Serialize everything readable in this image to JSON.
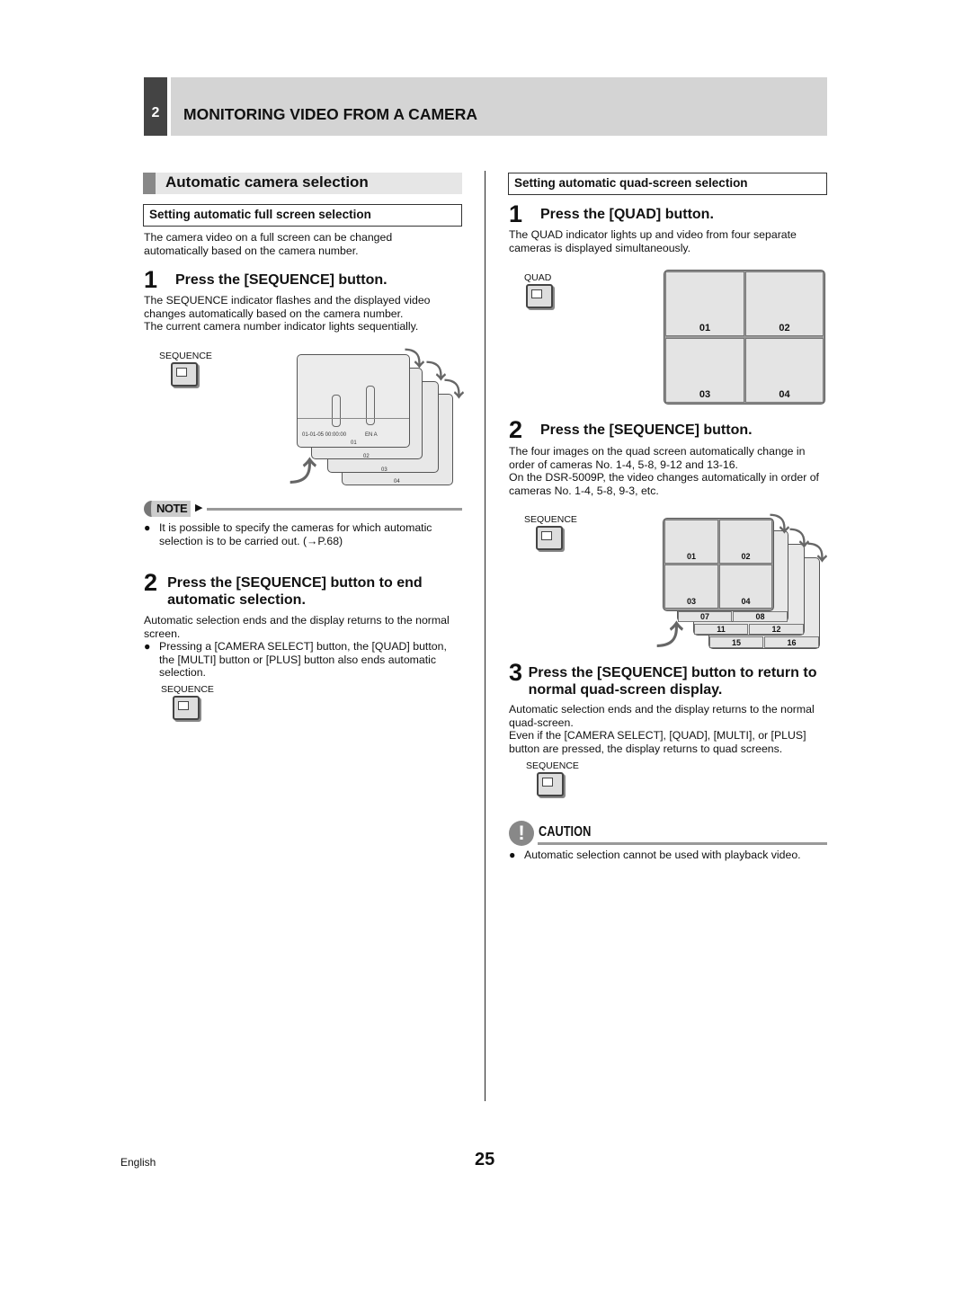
{
  "chapter": {
    "number": "2",
    "title": "MONITORING VIDEO FROM A CAMERA"
  },
  "section": {
    "title": "Automatic camera selection"
  },
  "left": {
    "subheading": "Setting automatic full screen selection",
    "intro": "The camera video on a full screen can be changed automatically based on the camera number.",
    "step1": {
      "num": "1",
      "title": "Press the [SEQUENCE] button.",
      "body": [
        "The SEQUENCE indicator flashes and the displayed video changes automatically based on the camera number.",
        "The current camera number indicator lights sequentially."
      ],
      "button_label": "SEQUENCE"
    },
    "screen_overlay": {
      "datetime": "01-01-05 00:00:00",
      "mode": "EN A",
      "cams": [
        "01",
        "02",
        "03",
        "04"
      ]
    },
    "note": {
      "label": "NOTE",
      "bullet": "It is possible to specify the cameras for which automatic selection is to be carried out. (→P.68)"
    },
    "step2": {
      "num": "2",
      "title": "Press the [SEQUENCE] button to end automatic selection.",
      "body": "Automatic selection ends and the display returns to the normal screen.",
      "bullet": "Pressing a [CAMERA SELECT] button, the [QUAD] button, the [MULTI] button or [PLUS] button also ends automatic selection.",
      "button_label": "SEQUENCE"
    }
  },
  "right": {
    "subheading": "Setting automatic quad-screen selection",
    "step1": {
      "num": "1",
      "title": "Press the [QUAD] button.",
      "body": "The QUAD indicator lights up and video from four separate cameras is displayed simultaneously.",
      "button_label": "QUAD",
      "cams": [
        "01",
        "02",
        "03",
        "04"
      ]
    },
    "step2": {
      "num": "2",
      "title": "Press the [SEQUENCE] button.",
      "body": [
        "The four images on the quad screen automatically change in order of cameras No. 1-4, 5-8, 9-12 and 13-16.",
        "On the DSR-5009P, the video changes automatically in order of cameras No. 1-4, 5-8, 9-3, etc."
      ],
      "button_label": "SEQUENCE",
      "cams": [
        "01",
        "02",
        "03",
        "04"
      ],
      "back_cams": [
        "07",
        "08",
        "11",
        "12",
        "15",
        "16"
      ]
    },
    "step3": {
      "num": "3",
      "title": "Press the [SEQUENCE] button to return to normal quad-screen display.",
      "body": [
        "Automatic selection ends and the display returns to the normal quad-screen.",
        "Even if the [CAMERA SELECT], [QUAD], [MULTI], or [PLUS] button are pressed, the display returns to quad screens."
      ],
      "button_label": "SEQUENCE"
    },
    "caution": {
      "label": "CAUTION",
      "bullet": "Automatic selection cannot be used with playback video."
    }
  },
  "footer": {
    "language": "English",
    "page": "25"
  },
  "colors": {
    "chapter_tab": "#444444",
    "chapter_band": "#d4d4d4",
    "section_band": "#e6e6e6",
    "section_marker": "#888888"
  }
}
